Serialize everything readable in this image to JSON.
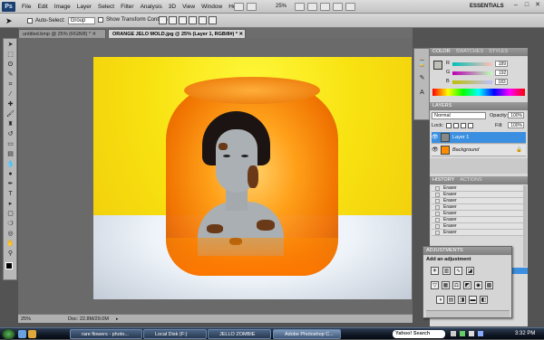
{
  "app": {
    "logo": "Ps"
  },
  "menu": [
    "File",
    "Edit",
    "Image",
    "Layer",
    "Select",
    "Filter",
    "Analysis",
    "3D",
    "View",
    "Window",
    "Help"
  ],
  "zoom_label": "25%",
  "workspace": "ESSENTIALS",
  "options": {
    "auto_select": "Auto-Select:",
    "auto_select_value": "Group",
    "transform": "Show Transform Controls"
  },
  "tabs": [
    {
      "label": "untitled.bmp @ 25% (RGB/8) *"
    },
    {
      "label": "ORANGE JELO MOLD.jpg @ 25% (Layer 1, RGB/8#) *"
    }
  ],
  "color_panel": {
    "tabs": [
      "COLOR",
      "SWATCHES",
      "STYLES"
    ],
    "r_label": "R",
    "g_label": "G",
    "b_label": "B",
    "r": "189",
    "g": "192",
    "b": "183"
  },
  "layers_panel": {
    "title": "LAYERS",
    "blend": "Normal",
    "opacity_label": "Opacity:",
    "opacity": "100%",
    "lock_label": "Lock:",
    "fill_label": "Fill:",
    "fill": "100%",
    "layers": [
      {
        "name": "Layer 1",
        "selected": true
      },
      {
        "name": "Background",
        "selected": false
      }
    ]
  },
  "history_panel": {
    "tabs": [
      "HISTORY",
      "ACTIONS"
    ],
    "items": [
      "Eraser",
      "Eraser",
      "Eraser",
      "Eraser",
      "Eraser",
      "Eraser",
      "Eraser",
      "Eraser"
    ]
  },
  "adjustments": {
    "title": "ADJUSTMENTS",
    "subtitle": "Add an adjustment"
  },
  "status": {
    "zoom": "25%",
    "doc": "Doc: 22.8M/29.0M"
  },
  "taskbar": {
    "buttons": [
      "rare flowers - photo...",
      "Local Disk (F:)",
      "JELLO ZOMBIE",
      "Adobe Photoshop C..."
    ],
    "search": "Yahoo! Search",
    "clock": "3:32 PM"
  },
  "colors": {
    "accent": "#3b8fe0",
    "jello": "#ff8a00",
    "bg": "#f8e211"
  }
}
